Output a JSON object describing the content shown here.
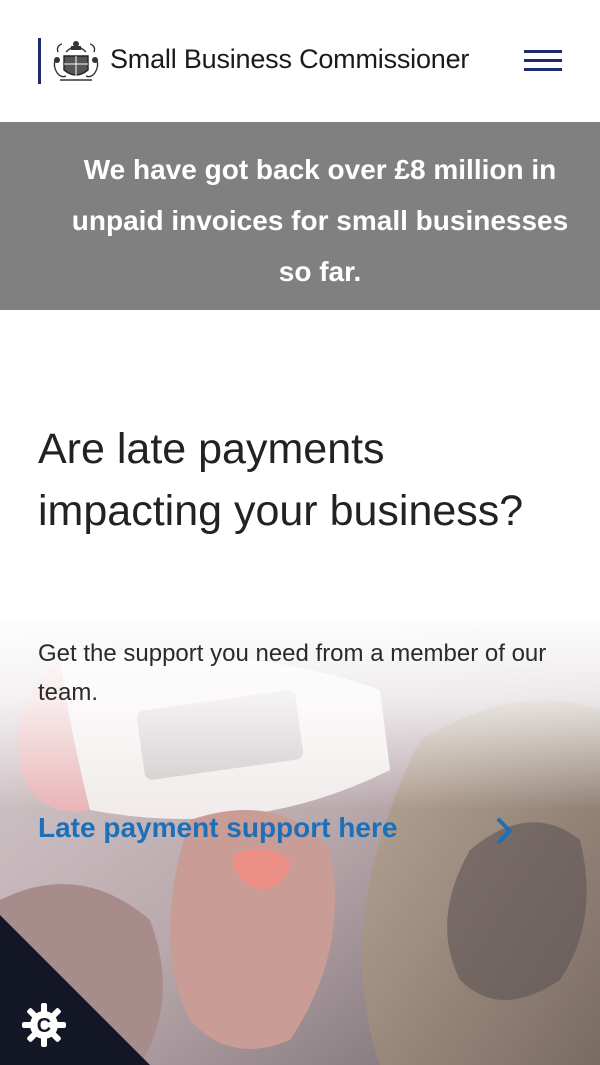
{
  "header": {
    "brand_name": "Small Business Commissioner",
    "logo_icon": "royal-crest-icon",
    "menu_icon": "hamburger-menu-icon",
    "accent_color": "#1d2a6b"
  },
  "banner": {
    "text": "We have got back over £8 million in unpaid invoices for small businesses so far.",
    "background_color": "#808080"
  },
  "hero": {
    "title": "Are late payments impacting your business?",
    "subtitle": "Get the support you need from a member of our team.",
    "cta_label": "Late payment support here",
    "cta_icon": "chevron-right-icon",
    "link_color": "#1d70b8"
  },
  "cookie_settings": {
    "icon": "cookie-settings-icon",
    "letter": "C",
    "background_color": "#141726"
  }
}
